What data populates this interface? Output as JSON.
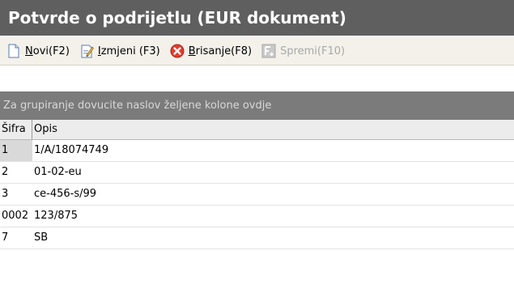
{
  "title": "Potvrde o podrijetlu (EUR dokument)",
  "toolbar": {
    "buttons": [
      {
        "hotkey": "N",
        "rest": "ovi(F2)",
        "icon": "new-document-icon",
        "disabled": false
      },
      {
        "hotkey": "I",
        "rest": "zmjeni (F3)",
        "icon": "edit-document-icon",
        "disabled": false
      },
      {
        "hotkey": "B",
        "rest": "risanje(F8)",
        "icon": "delete-icon",
        "disabled": false
      },
      {
        "hotkey": "",
        "rest": "Spremi(F10)",
        "icon": "save-icon",
        "disabled": true
      }
    ]
  },
  "group_panel": {
    "text": "Za grupiranje dovucite naslov željene kolone ovdje"
  },
  "table": {
    "columns": [
      "Šifra",
      "Opis"
    ],
    "rows": [
      [
        "1",
        "1/A/18074749"
      ],
      [
        "2",
        "01-02-eu"
      ],
      [
        "3",
        "ce-456-s/99"
      ],
      [
        "0002",
        "123/875"
      ],
      [
        "7",
        "SB"
      ]
    ]
  },
  "colors": {
    "title_bg": "#5f5f5f",
    "toolbar_bg": "#f3f1ea",
    "group_panel_bg": "#7b7b7b",
    "delete_icon": "#e53b2a"
  }
}
